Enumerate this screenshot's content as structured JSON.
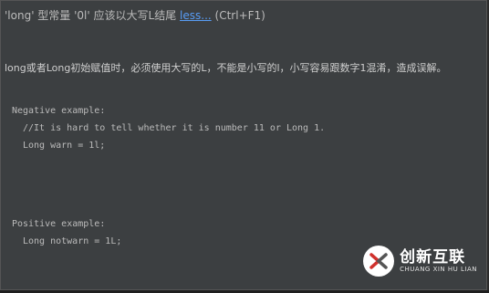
{
  "header": {
    "text": "'long' 型常量 '0l' 应该以大写L结尾",
    "more_link": "less...",
    "shortcut": "(Ctrl+F1)"
  },
  "description": "long或者Long初始赋值时，必须使用大写的L，不能是小写的l，小写容易跟数字1混淆，造成误解。",
  "negative": {
    "label": "Negative example:",
    "comment": "//It is hard to tell whether it is number 11 or Long 1.",
    "code": "Long warn = 1l;"
  },
  "positive": {
    "label": "Positive example:",
    "code": "Long notwarn = 1L;"
  },
  "watermark": {
    "main": "创新互联",
    "sub": "CHUANG XIN HU LIAN"
  }
}
